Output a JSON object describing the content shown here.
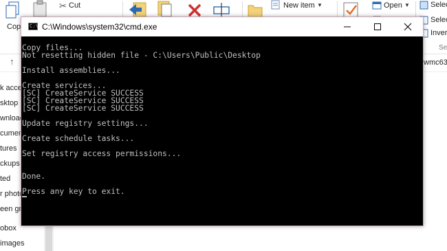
{
  "ribbon": {
    "copy_label": "Copy",
    "cut_label": "Cut",
    "new_item_label": "New item",
    "open_label": "Open",
    "select_all_label": "Select",
    "select_none_label": "Select",
    "invert_label": "Invert",
    "group_suffix": "Se"
  },
  "address": {
    "breadcrumb_tail": "wmc63-"
  },
  "nav": {
    "items": [
      "k acce",
      "sktop",
      "wnload",
      "cumen",
      "tures",
      "ckups",
      "ted",
      "r photo",
      "een gr",
      "obox",
      "images"
    ]
  },
  "cmd": {
    "title": "C:\\Windows\\system32\\cmd.exe",
    "icon_text": "C:\\",
    "lines": [
      "Copy files...",
      "Not resetting hidden file - C:\\Users\\Public\\Desktop",
      "",
      "Install assemblies...",
      "",
      "Create services...",
      "[SC] CreateService SUCCESS",
      "[SC] CreateService SUCCESS",
      "[SC] CreateService SUCCESS",
      "",
      "Update registry settings...",
      "",
      "Create schedule tasks...",
      "",
      "Set registry access permissions...",
      "",
      "",
      "Done.",
      "",
      "Press any key to exit."
    ]
  },
  "colors": {
    "console_bg": "#000000",
    "console_text": "#c0c0c0",
    "window_border": "#c9a9b8",
    "ribbon_blue": "#2b6cb0",
    "delete_red": "#d32f2f"
  }
}
